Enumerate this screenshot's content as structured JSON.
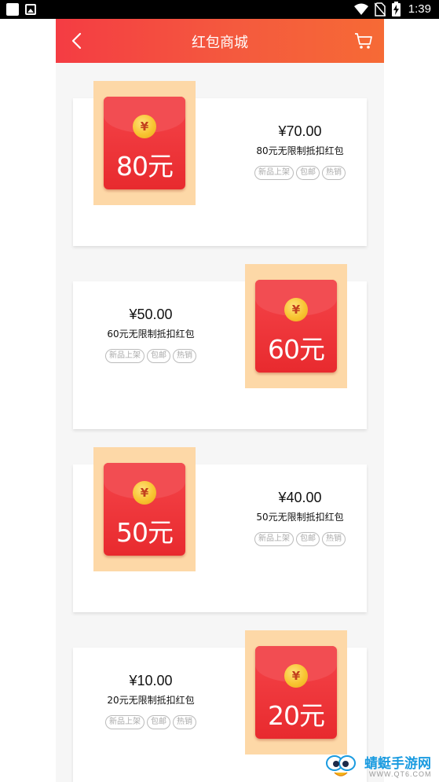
{
  "status_bar": {
    "time": "1:39",
    "icons": [
      "app-notification-icon",
      "gallery-icon",
      "wifi-icon",
      "no-sim-icon",
      "battery-charging-icon"
    ]
  },
  "header": {
    "title": "红包商城",
    "back_icon": "chevron-left-icon",
    "cart_icon": "cart-icon",
    "gradient": [
      "#f43c43",
      "#f66a35"
    ]
  },
  "products": [
    {
      "face_value": "80元",
      "currency_symbol": "¥",
      "price": "¥70.00",
      "name": "80元无限制抵扣红包",
      "tags": [
        "新品上架",
        "包邮",
        "热销"
      ]
    },
    {
      "face_value": "60元",
      "currency_symbol": "¥",
      "price": "¥50.00",
      "name": "60元无限制抵扣红包",
      "tags": [
        "新品上架",
        "包邮",
        "热销"
      ]
    },
    {
      "face_value": "50元",
      "currency_symbol": "¥",
      "price": "¥40.00",
      "name": "50元无限制抵扣红包",
      "tags": [
        "新品上架",
        "包邮",
        "热销"
      ]
    },
    {
      "face_value": "20元",
      "currency_symbol": "¥",
      "price": "¥10.00",
      "name": "20元无限制抵扣红包",
      "tags": [
        "新品上架",
        "包邮",
        "热销"
      ]
    }
  ],
  "colors": {
    "envelope": "#e82a2e",
    "envelope_backdrop": "#fdd8a7",
    "coin": "#f8c431",
    "page_background": "#f6f6f6"
  },
  "watermark": {
    "title": "蜻蜓手游网",
    "url": "WWW.QT6.COM"
  }
}
